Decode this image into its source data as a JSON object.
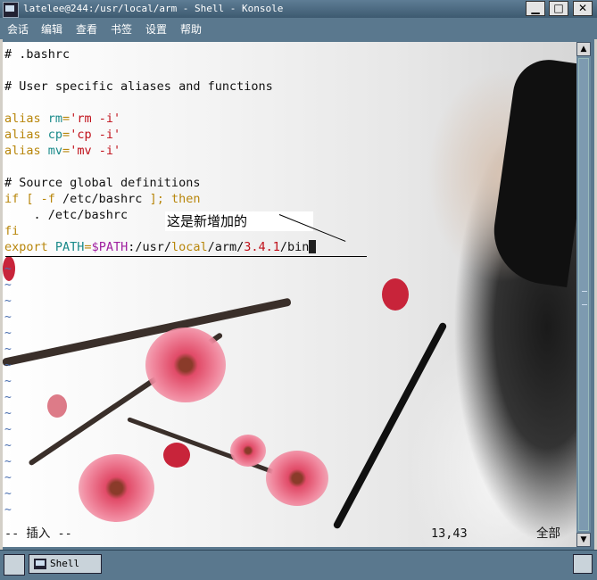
{
  "window": {
    "title": "latelee@244:/usr/local/arm - Shell - Konsole",
    "minimize_glyph": "▁",
    "maximize_glyph": "□",
    "close_glyph": "✕"
  },
  "menu": [
    "会话",
    "编辑",
    "查看",
    "书签",
    "设置",
    "帮助"
  ],
  "terminal": {
    "lines": {
      "l1": "# .bashrc",
      "l2": "# User specific aliases and functions",
      "l3a": "alias ",
      "l3b": "rm",
      "l3c": "=",
      "l3d": "'rm -i'",
      "l4a": "alias ",
      "l4b": "cp",
      "l4c": "=",
      "l4d": "'cp -i'",
      "l5a": "alias ",
      "l5b": "mv",
      "l5c": "=",
      "l5d": "'mv -i'",
      "l6": "# Source global definitions",
      "l7a": "if [ -f ",
      "l7b": "/etc/bashrc",
      "l7c": " ]; then",
      "l8": "    . /etc/bashrc",
      "l9": "fi",
      "l10a": "export ",
      "l10b": "PATH",
      "l10c": "=",
      "l10d": "$PATH",
      "l10e": ":/usr/",
      "l10f": "local",
      "l10g": "/arm/",
      "l10h": "3.4.1",
      "l10i": "/bin"
    },
    "tilde": "~",
    "annotation": "这是新增加的",
    "status_mode": "-- 插入 --",
    "status_pos": "13,43",
    "status_view": "全部"
  },
  "taskbar": {
    "tab_label": "Shell"
  },
  "colors": {
    "keyword": "#b8860b",
    "string": "#c0101a",
    "variable": "#a020a0",
    "identifier": "#1a8a8a",
    "tilde": "#4a6fb0",
    "chrome": "#5a788e"
  },
  "icons": [
    "terminal-app-icon",
    "new-session-icon",
    "terminal-tab-icon",
    "taskbar-close-icon"
  ]
}
